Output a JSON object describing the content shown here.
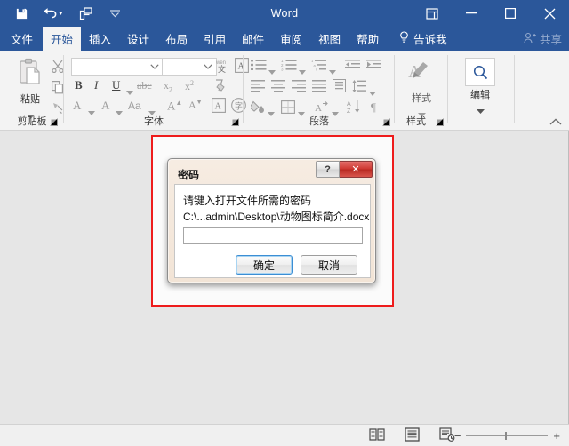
{
  "window": {
    "title": "Word",
    "quick_access": [
      {
        "name": "save-button",
        "icon": "save-icon"
      },
      {
        "name": "undo-button",
        "icon": "undo-icon"
      },
      {
        "name": "redo-button",
        "icon": "redo-icon"
      },
      {
        "name": "customize-qat-button",
        "icon": "chevron-down-icon"
      }
    ],
    "controls": [
      {
        "name": "ribbon-display-options-button",
        "icon": "ribbon-options-icon"
      },
      {
        "name": "minimize-button",
        "icon": "minimize-icon"
      },
      {
        "name": "maximize-button",
        "icon": "maximize-icon"
      },
      {
        "name": "close-button",
        "icon": "close-icon"
      }
    ],
    "accent_color": "#2b579a"
  },
  "tabs": [
    {
      "label": "文件",
      "active": false
    },
    {
      "label": "开始",
      "active": true
    },
    {
      "label": "插入",
      "active": false
    },
    {
      "label": "设计",
      "active": false
    },
    {
      "label": "布局",
      "active": false
    },
    {
      "label": "引用",
      "active": false
    },
    {
      "label": "邮件",
      "active": false
    },
    {
      "label": "审阅",
      "active": false
    },
    {
      "label": "视图",
      "active": false
    },
    {
      "label": "帮助",
      "active": false
    }
  ],
  "tell_me": {
    "label": "告诉我",
    "icon": "lightbulb-icon"
  },
  "share": {
    "label": "共享",
    "icon": "share-person-icon"
  },
  "ribbon": {
    "groups": [
      {
        "label": "剪贴板",
        "paste_label": "粘贴"
      },
      {
        "label": "字体"
      },
      {
        "label": "段落"
      },
      {
        "label": "样式",
        "button_label": "样式"
      },
      {
        "label": "",
        "button_label": "编辑"
      }
    ],
    "font_name_value": "",
    "font_size_value": "",
    "collapse_icon": "chevron-up-icon"
  },
  "dialog": {
    "title": "密码",
    "help_label": "?",
    "close_label": "✕",
    "prompt": "请键入打开文件所需的密码",
    "file_path": "C:\\...admin\\Desktop\\动物图标简介.docx",
    "password_value": "",
    "password_placeholder": "",
    "ok_label": "确定",
    "cancel_label": "取消"
  },
  "annotation": {
    "color": "#ee1c1c"
  },
  "statusbar": {
    "views": [
      {
        "name": "read-mode-view-button",
        "icon": "read-mode-icon"
      },
      {
        "name": "print-layout-view-button",
        "icon": "print-layout-icon"
      },
      {
        "name": "web-layout-view-button",
        "icon": "web-layout-icon"
      }
    ],
    "zoom_out_label": "−",
    "zoom_in_label": "+"
  }
}
